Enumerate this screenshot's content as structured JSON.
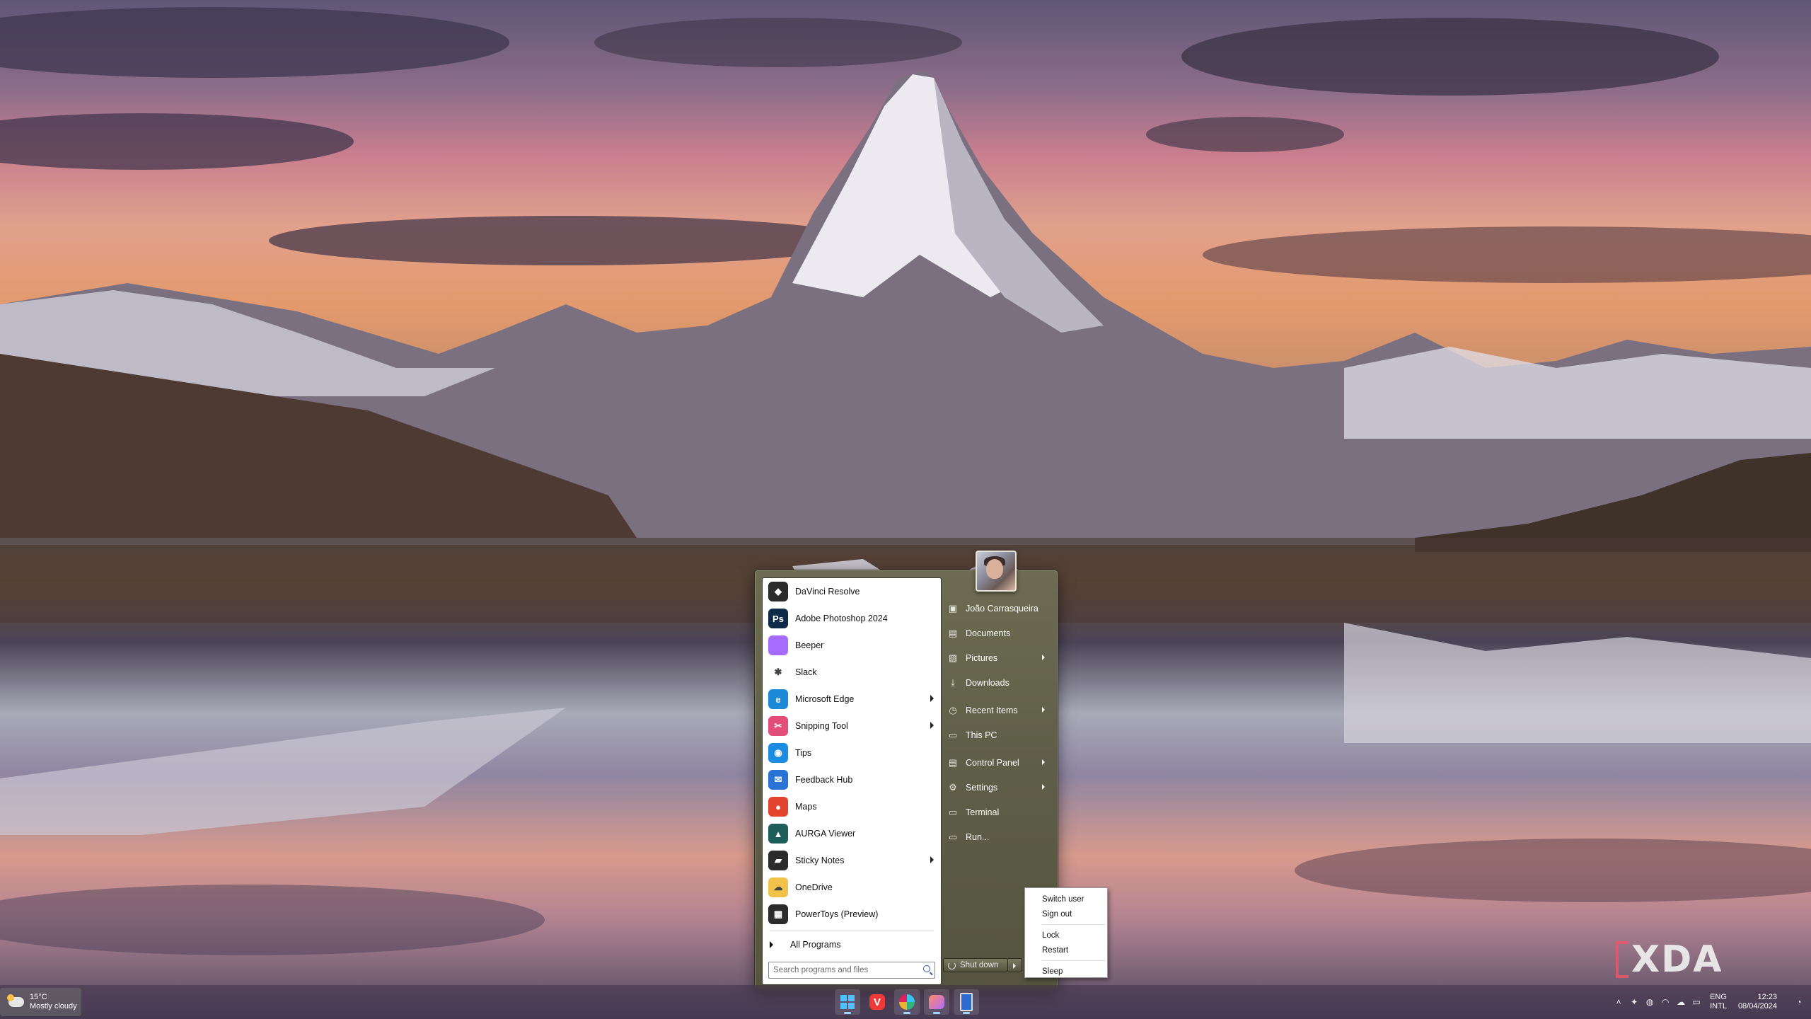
{
  "start_menu": {
    "apps": [
      {
        "label": "DaVinci Resolve",
        "icon": "davinci-resolve-icon",
        "color": "#2b2b2b",
        "glyph": "◆",
        "submenu": false
      },
      {
        "label": "Adobe Photoshop 2024",
        "icon": "photoshop-icon",
        "color": "#0d2a48",
        "glyph": "Ps",
        "submenu": false
      },
      {
        "label": "Beeper",
        "icon": "beeper-icon",
        "color": "#a56cff",
        "glyph": "",
        "submenu": false
      },
      {
        "label": "Slack",
        "icon": "slack-icon",
        "color": "#ffffff",
        "glyph": "✱",
        "submenu": false
      },
      {
        "label": "Microsoft Edge",
        "icon": "edge-icon",
        "color": "#1c8ad8",
        "glyph": "e",
        "submenu": true
      },
      {
        "label": "Snipping Tool",
        "icon": "snipping-tool-icon",
        "color": "#e34d7a",
        "glyph": "✂",
        "submenu": true
      },
      {
        "label": "Tips",
        "icon": "tips-icon",
        "color": "#1b8de3",
        "glyph": "◉",
        "submenu": false
      },
      {
        "label": "Feedback Hub",
        "icon": "feedback-hub-icon",
        "color": "#2a73d6",
        "glyph": "✉",
        "submenu": false
      },
      {
        "label": "Maps",
        "icon": "maps-icon",
        "color": "#e2442f",
        "glyph": "●",
        "submenu": false
      },
      {
        "label": "AURGA Viewer",
        "icon": "aurga-viewer-icon",
        "color": "#1e5e5a",
        "glyph": "▲",
        "submenu": false
      },
      {
        "label": "Sticky Notes",
        "icon": "sticky-notes-icon",
        "color": "#2b2b2b",
        "glyph": "▰",
        "submenu": true
      },
      {
        "label": "OneDrive",
        "icon": "onedrive-icon",
        "color": "#f1c24a",
        "glyph": "☁",
        "submenu": false
      },
      {
        "label": "PowerToys (Preview)",
        "icon": "powertoys-icon",
        "color": "#2b2b2b",
        "glyph": "▦",
        "submenu": false
      }
    ],
    "all_programs": "All Programs",
    "search_placeholder": "Search programs and files",
    "places": [
      {
        "label": "João Carrasqueira",
        "icon": "user-folder-icon",
        "glyph": "▣",
        "submenu": false
      },
      {
        "label": "Documents",
        "icon": "documents-icon",
        "glyph": "▤",
        "submenu": false
      },
      {
        "label": "Pictures",
        "icon": "pictures-icon",
        "glyph": "▧",
        "submenu": true
      },
      {
        "label": "Downloads",
        "icon": "downloads-icon",
        "glyph": "⤓",
        "submenu": false
      },
      {
        "label": "Recent Items",
        "icon": "recent-items-icon",
        "glyph": "◷",
        "submenu": true
      },
      {
        "label": "This PC",
        "icon": "this-pc-icon",
        "glyph": "▭",
        "submenu": false
      },
      {
        "label": "Control Panel",
        "icon": "control-panel-icon",
        "glyph": "▤",
        "submenu": true
      },
      {
        "label": "Settings",
        "icon": "settings-gear-icon",
        "glyph": "⚙",
        "submenu": true
      },
      {
        "label": "Terminal",
        "icon": "terminal-icon",
        "glyph": "▭",
        "submenu": false
      },
      {
        "label": "Run...",
        "icon": "run-icon",
        "glyph": "▭",
        "submenu": false
      }
    ],
    "shutdown_label": "Shut down"
  },
  "power_menu": {
    "group1": [
      "Switch user",
      "Sign out"
    ],
    "group2": [
      "Lock",
      "Restart"
    ],
    "group3": [
      "Sleep"
    ]
  },
  "taskbar": {
    "weather": {
      "temp": "15°C",
      "condition": "Mostly cloudy"
    },
    "pinned": [
      "start-button",
      "vivaldi-icon",
      "slack-icon",
      "beeper-icon",
      "document-icon"
    ],
    "tray": {
      "lang_top": "ENG",
      "lang_bottom": "INTL",
      "time": "12:23",
      "date": "08/04/2024"
    }
  },
  "watermark": "XDA"
}
